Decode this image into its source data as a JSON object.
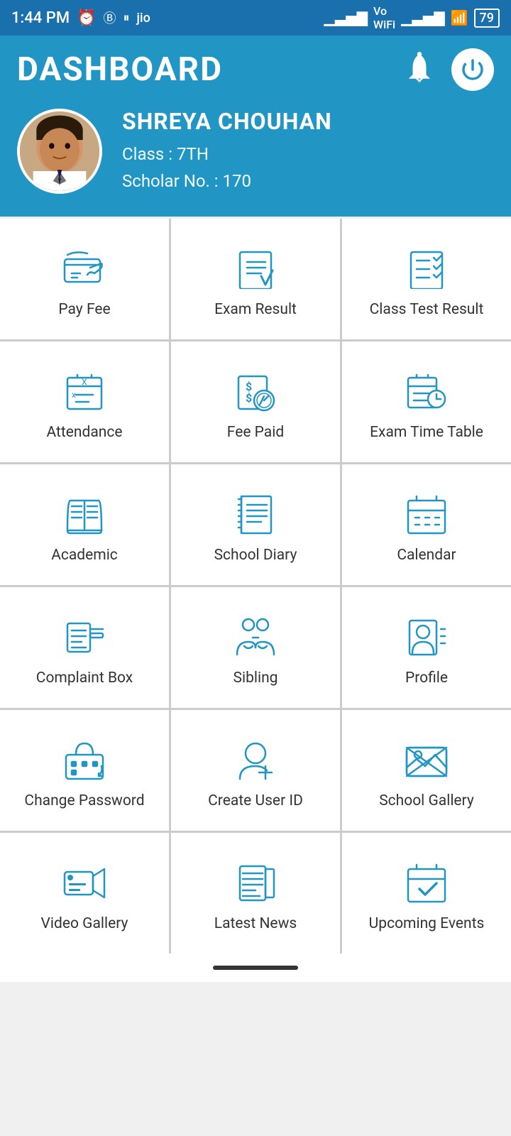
{
  "statusBar": {
    "time": "1:44 PM",
    "battery": "79"
  },
  "header": {
    "title": "DASHBOARD",
    "bellIcon": "bell-icon",
    "powerIcon": "power-icon"
  },
  "profile": {
    "name": "SHREYA  CHOUHAN",
    "classLabel": "Class : 7TH",
    "scholarLabel": "Scholar No. : 170"
  },
  "gridItems": [
    {
      "id": "pay-fee",
      "label": "Pay Fee",
      "icon": "payment"
    },
    {
      "id": "exam-result",
      "label": "Exam Result",
      "icon": "result"
    },
    {
      "id": "class-test-result",
      "label": "Class Test Result",
      "icon": "classtest"
    },
    {
      "id": "attendance",
      "label": "Attendance",
      "icon": "attendance"
    },
    {
      "id": "fee-paid",
      "label": "Fee Paid",
      "icon": "feepaid"
    },
    {
      "id": "exam-time-table",
      "label": "Exam Time Table",
      "icon": "timetable"
    },
    {
      "id": "academic",
      "label": "Academic",
      "icon": "academic"
    },
    {
      "id": "school-diary",
      "label": "School Diary",
      "icon": "diary"
    },
    {
      "id": "calendar",
      "label": "Calendar",
      "icon": "calendar"
    },
    {
      "id": "complaint-box",
      "label": "Complaint Box",
      "icon": "complaint"
    },
    {
      "id": "sibling",
      "label": "Sibling",
      "icon": "sibling"
    },
    {
      "id": "profile",
      "label": "Profile",
      "icon": "profile"
    },
    {
      "id": "change-password",
      "label": "Change Password",
      "icon": "changepassword"
    },
    {
      "id": "create-user-id",
      "label": "Create User ID",
      "icon": "createuser"
    },
    {
      "id": "school-gallery",
      "label": "School Gallery",
      "icon": "gallery"
    },
    {
      "id": "video-gallery",
      "label": "Video Gallery",
      "icon": "videogallery"
    },
    {
      "id": "latest-news",
      "label": "Latest News",
      "icon": "latestnews"
    },
    {
      "id": "upcoming-events",
      "label": "Upcoming Events",
      "icon": "upcomingevents"
    }
  ]
}
